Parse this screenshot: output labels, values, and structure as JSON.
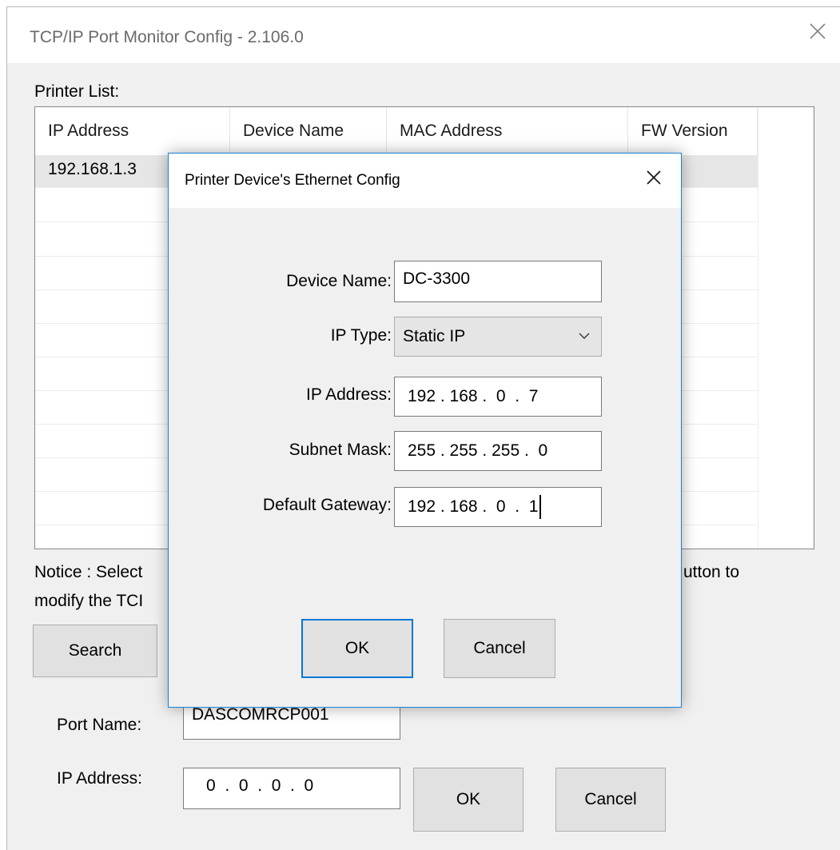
{
  "window": {
    "title": "TCP/IP Port Monitor Config - 2.106.0",
    "close_icon": "close-icon"
  },
  "printer_list": {
    "label": "Printer List:",
    "columns": [
      "IP Address",
      "Device Name",
      "MAC Address",
      "FW Version"
    ],
    "rows": [
      {
        "ip": "192.168.1.3"
      }
    ]
  },
  "notice": {
    "line1_start": "Notice : Select",
    "line1_end": "utton to",
    "line2_start": "modify the TCI"
  },
  "buttons": {
    "search": "Search",
    "ok": "OK",
    "cancel": "Cancel"
  },
  "port": {
    "name_label": "Port Name:",
    "name_value": "DASCOMRCP001",
    "ip_label": "IP Address:",
    "ip_value": "0  .  0  .  0  .  0"
  },
  "dialog": {
    "title": "Printer Device's Ethernet Config",
    "fields": {
      "device_name_label": "Device Name:",
      "device_name_value": "DC-3300",
      "ip_type_label": "IP Type:",
      "ip_type_value": "Static IP",
      "ip_address_label": "IP Address:",
      "ip_address_value": "192 . 168 .  0  .  7",
      "subnet_label": "Subnet Mask:",
      "subnet_value": "255 . 255 . 255 .  0",
      "gateway_label": "Default Gateway:",
      "gateway_value": "192 . 168 .  0  .  1"
    },
    "ok": "OK",
    "cancel": "Cancel"
  },
  "colors": {
    "window_bg": "#f0f0f0",
    "accent": "#0078d7",
    "dialog_border": "#1883d7",
    "button_bg": "#e1e1e1"
  }
}
